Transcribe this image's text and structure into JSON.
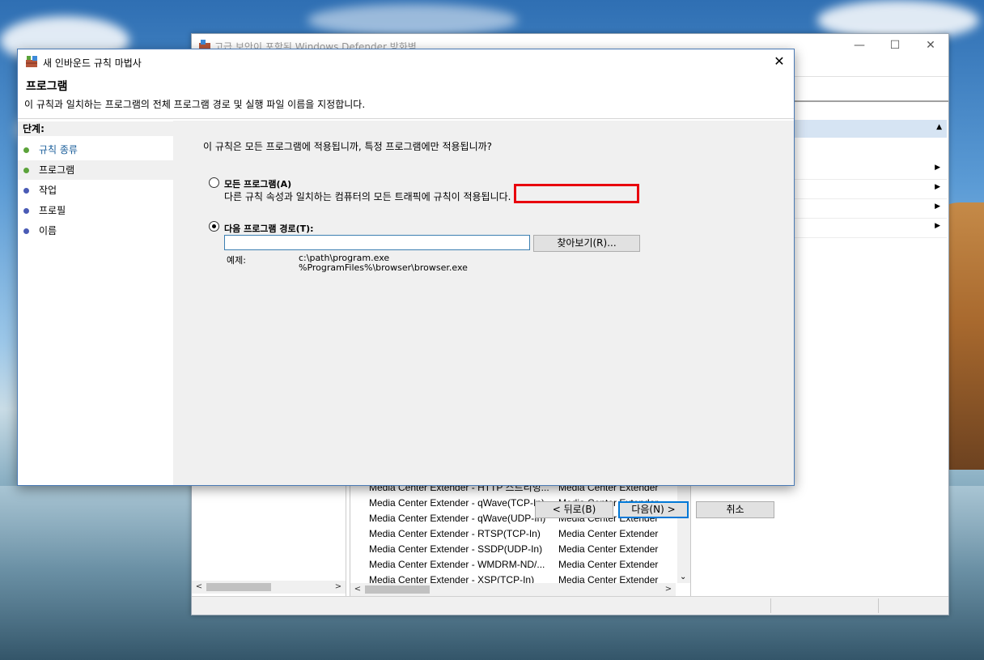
{
  "background_window": {
    "title": "고급 보안이 포함된 Windows Defender 방화벽",
    "controls": {
      "minimize": "—",
      "maximize": "☐",
      "close": "✕"
    },
    "actions_arrows": [
      "▶",
      "▶",
      "▶",
      "▶"
    ],
    "list_rows": [
      {
        "name": "Media Center Extender - HTTP 스트리밍...",
        "group": "Media Center Extender"
      },
      {
        "name": "Media Center Extender - qWave(TCP-In)",
        "group": "Media Center Extender"
      },
      {
        "name": "Media Center Extender - qWave(UDP-In)",
        "group": "Media Center Extender"
      },
      {
        "name": "Media Center Extender - RTSP(TCP-In)",
        "group": "Media Center Extender"
      },
      {
        "name": "Media Center Extender - SSDP(UDP-In)",
        "group": "Media Center Extender"
      },
      {
        "name": "Media Center Extender - WMDRM-ND/...",
        "group": "Media Center Extender"
      },
      {
        "name": "Media Center Extender - XSP(TCP-In)",
        "group": "Media Center Extender"
      }
    ]
  },
  "dialog": {
    "title": "새 인바운드 규칙 마법사",
    "close_glyph": "✕",
    "page_title": "프로그램",
    "page_description": "이 규칙과 일치하는 프로그램의 전체 프로그램 경로 및 실행 파일 이름을 지정합니다.",
    "steps_header": "단계:",
    "steps": [
      {
        "label": "규칙 종류",
        "state": "done",
        "color": "#5ba33a"
      },
      {
        "label": "프로그램",
        "state": "current",
        "color": "#5ba33a"
      },
      {
        "label": "작업",
        "state": "pending",
        "color": "#4a5bb5"
      },
      {
        "label": "프로필",
        "state": "pending",
        "color": "#4a5bb5"
      },
      {
        "label": "이름",
        "state": "pending",
        "color": "#4a5bb5"
      }
    ],
    "question": "이 규칙은 모든 프로그램에 적용됩니까, 특정 프로그램에만 적용됩니까?",
    "option_all": {
      "label": "모든 프로그램(A)",
      "description": "다른 규칙 속성과 일치하는 컴퓨터의 모든 트래픽에 규칙이 적용됩니다.",
      "selected": false
    },
    "option_path": {
      "label": "다음 프로그램 경로(T):",
      "selected": true
    },
    "path_value": "",
    "browse_button": "찾아보기(R)...",
    "example_label": "예제:",
    "example_lines": "c:\\path\\program.exe\n%ProgramFiles%\\browser\\browser.exe",
    "buttons": {
      "back": "< 뒤로(B)",
      "next": "다음(N) >",
      "cancel": "취소"
    },
    "highlight_color": "#e8000d"
  }
}
